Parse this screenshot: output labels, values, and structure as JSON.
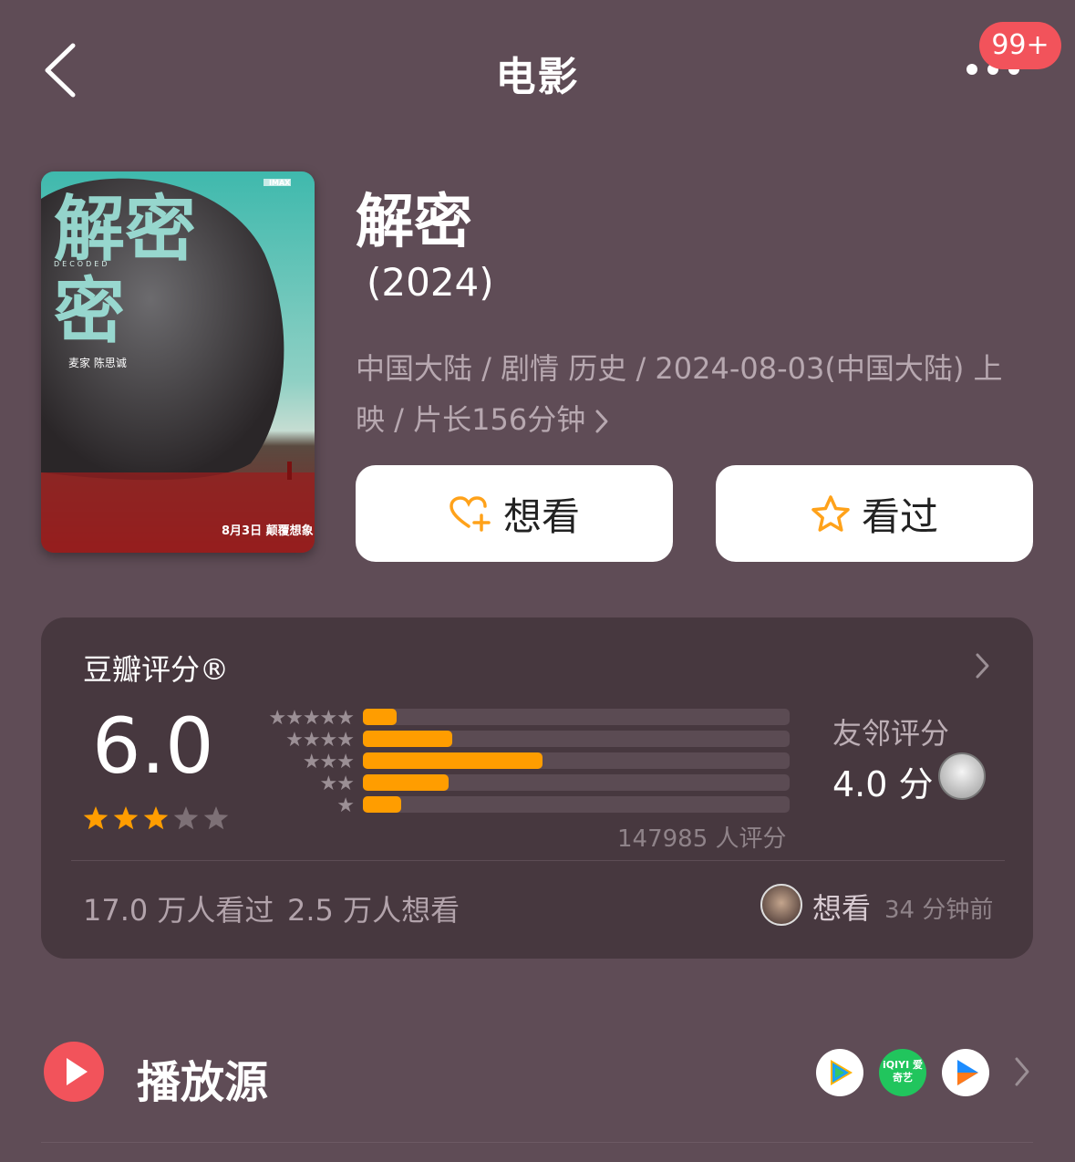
{
  "header": {
    "title": "电影",
    "badge": "99+"
  },
  "movie": {
    "title": "解密",
    "year": "(2024)",
    "meta": "中国大陆 / 剧情 历史 / 2024-08-03(中国大陆) 上映 / 片长156分钟",
    "want_label": "想看",
    "seen_label": "看过",
    "poster": {
      "title_glyphs": "解密",
      "subtitle": "DECODED",
      "credit": "麦家 陈思诚",
      "imax": "IMAX",
      "release": "8月3日 颠覆想象"
    }
  },
  "rating": {
    "title": "豆瓣评分®",
    "score": "6.0",
    "stars": 3,
    "distribution": [
      {
        "stars": "★★★★★",
        "percent": 8
      },
      {
        "stars": "★★★★",
        "percent": 21
      },
      {
        "stars": "★★★",
        "percent": 42
      },
      {
        "stars": "★★",
        "percent": 20
      },
      {
        "stars": "★",
        "percent": 9
      }
    ],
    "rater_count": "147985 人评分",
    "friend_label": "友邻评分",
    "friend_score": "4.0 分",
    "seen_count": "17.0 万人看过",
    "want_count": "2.5 万人想看",
    "activity_action": "想看",
    "activity_time": "34 分钟前"
  },
  "play": {
    "label": "播放源",
    "sources": [
      "tencent-video-icon",
      "iqiyi-icon",
      "youku-icon"
    ],
    "iqiyi_text": "iQIYI 爱奇艺"
  },
  "colors": {
    "background": "#5f4c56",
    "card": "#47383f",
    "accent": "#ff9d00",
    "red": "#f2535b"
  }
}
